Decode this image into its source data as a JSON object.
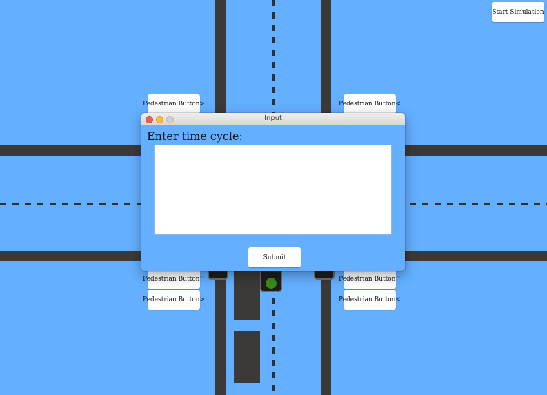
{
  "app": {
    "start_button_label": "Start Simulation"
  },
  "pedestrian_buttons": {
    "top_left": "Pedestrian Button>",
    "top_right": "Pedestrian Button<",
    "bottom_left_up": "Pedestrian Button^",
    "bottom_left_right": "Pedestrian Button>",
    "bottom_right_up": "Pedestrian Button^",
    "bottom_right_left": "Pedestrian Button<"
  },
  "dialog": {
    "title": "Input",
    "prompt": "Enter time cycle:",
    "input_value": "",
    "submit_label": "Submit"
  },
  "colors": {
    "background": "#64afff",
    "road": "#3b3a38",
    "green_light": "#3a8a1c",
    "close_button": "#ee5f57",
    "minimize_button": "#f5be41"
  }
}
